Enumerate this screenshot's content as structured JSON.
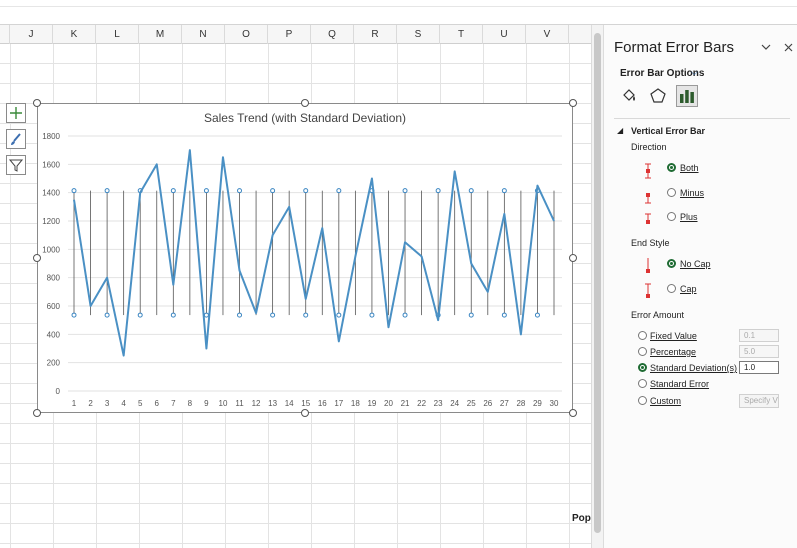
{
  "spreadsheet": {
    "columns": [
      "J",
      "K",
      "L",
      "M",
      "N",
      "O",
      "P",
      "Q",
      "R",
      "S",
      "T",
      "U",
      "V"
    ],
    "cell_pop": "Pop"
  },
  "chart_data": {
    "type": "line",
    "title": "Sales Trend (with Standard Deviation)",
    "x": [
      1,
      2,
      3,
      4,
      5,
      6,
      7,
      8,
      9,
      10,
      11,
      12,
      13,
      14,
      15,
      16,
      17,
      18,
      19,
      20,
      21,
      22,
      23,
      24,
      25,
      26,
      27,
      28,
      29,
      30
    ],
    "series": [
      {
        "values": [
          1350,
          600,
          800,
          250,
          1400,
          1600,
          750,
          1700,
          300,
          1650,
          850,
          550,
          1100,
          1300,
          650,
          1150,
          350,
          950,
          1500,
          450,
          1050,
          950,
          500,
          1550,
          900,
          700,
          1250,
          400,
          1450,
          1200
        ],
        "color": "#4a90c4"
      }
    ],
    "error_bars": {
      "upper": 1414,
      "lower": 536,
      "style": "both",
      "end_style": "no-cap",
      "amount": "standard-deviation",
      "value": 1.0
    },
    "ylim": [
      0,
      1800
    ],
    "yticks": [
      0,
      200,
      400,
      600,
      800,
      1000,
      1200,
      1400,
      1600,
      1800
    ],
    "grid": true,
    "legend": "none"
  },
  "pane": {
    "title": "Format Error Bars",
    "options_label": "Error Bar Options",
    "section": "Vertical Error Bar",
    "direction_label": "Direction",
    "direction": [
      {
        "label": "Both",
        "selected": true
      },
      {
        "label": "Minus",
        "selected": false
      },
      {
        "label": "Plus",
        "selected": false
      }
    ],
    "end_style_label": "End Style",
    "end_style": [
      {
        "label": "No Cap",
        "selected": true
      },
      {
        "label": "Cap",
        "selected": false
      }
    ],
    "error_amount_label": "Error Amount",
    "error_amount": [
      {
        "label": "Fixed Value",
        "value": "0.1",
        "selected": false
      },
      {
        "label": "Percentage",
        "value": "5.0",
        "selected": false
      },
      {
        "label": "Standard Deviation(s)",
        "value": "1.0",
        "selected": true
      },
      {
        "label": "Standard Error",
        "value": "",
        "selected": false
      },
      {
        "label": "Custom",
        "value": "",
        "selected": false
      }
    ],
    "specify_label": "Specify V",
    "icons": {
      "collapse": "chevron-down-icon",
      "close": "close-icon"
    }
  }
}
